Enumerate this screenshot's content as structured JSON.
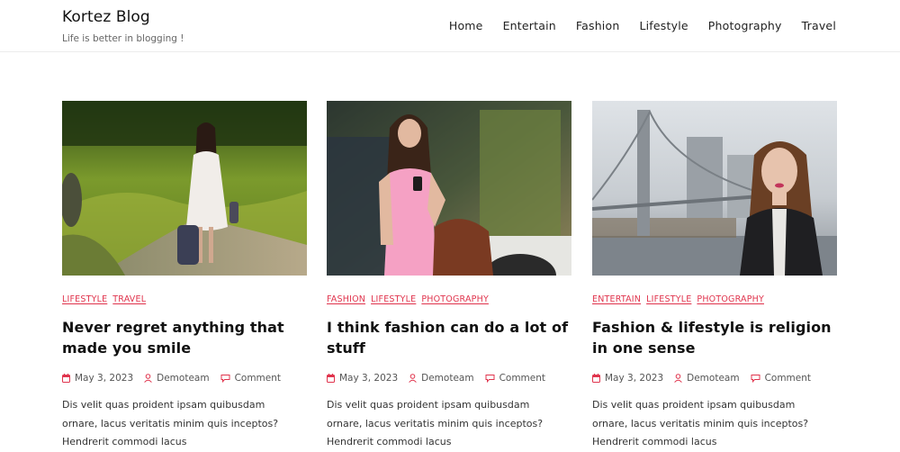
{
  "site": {
    "title": "Kortez Blog",
    "tagline": "Life is better in blogging !"
  },
  "nav": {
    "items": [
      "Home",
      "Entertain",
      "Fashion",
      "Lifestyle",
      "Photography",
      "Travel"
    ]
  },
  "posts": [
    {
      "categories": [
        "LIFESTYLE",
        "TRAVEL"
      ],
      "title": "Never regret anything that made you smile",
      "date": "May 3, 2023",
      "author": "Demoteam",
      "comment": "Comment",
      "excerpt": "Dis velit quas proident ipsam quibusdam ornare, lacus veritatis minim quis inceptos? Hendrerit commodi lacus"
    },
    {
      "categories": [
        "FASHION",
        "LIFESTYLE",
        "PHOTOGRAPHY"
      ],
      "title": "I think fashion can do a lot of stuff",
      "date": "May 3, 2023",
      "author": "Demoteam",
      "comment": "Comment",
      "excerpt": "Dis velit quas proident ipsam quibusdam ornare, lacus veritatis minim quis inceptos? Hendrerit commodi lacus"
    },
    {
      "categories": [
        "ENTERTAIN",
        "LIFESTYLE",
        "PHOTOGRAPHY"
      ],
      "title": "Fashion & lifestyle is religion in one sense",
      "date": "May 3, 2023",
      "author": "Demoteam",
      "comment": "Comment",
      "excerpt": "Dis velit quas proident ipsam quibusdam ornare, lacus veritatis minim quis inceptos? Hendrerit commodi lacus"
    }
  ],
  "icons": {
    "date": "calendar-icon",
    "author": "user-icon",
    "comment": "comment-icon"
  },
  "colors": {
    "accent": "#e0344d",
    "text": "#111111",
    "muted": "#555555"
  }
}
